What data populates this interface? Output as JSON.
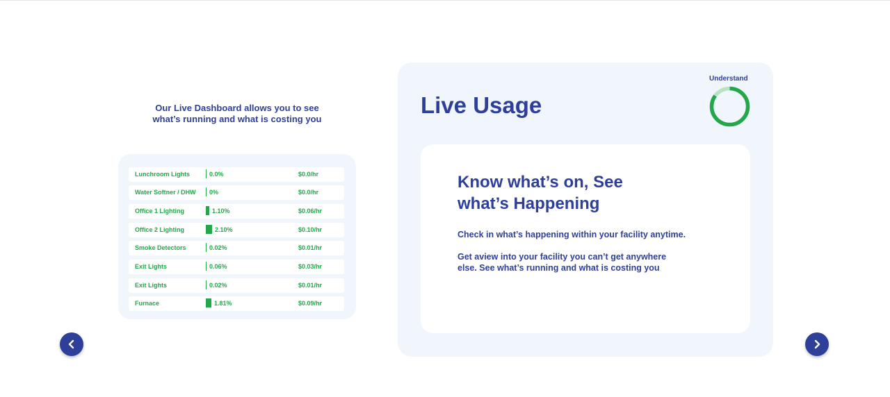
{
  "intro": {
    "line1": "Our Live Dashboard allows you to see",
    "line2": "what’s running and what is costing you"
  },
  "usage": [
    {
      "name": "Lunchroom Lights",
      "percent": "0.0%",
      "percent_value": 0.0,
      "cost": "$0.0/hr"
    },
    {
      "name": "Water Softner / DHW",
      "percent": "0%",
      "percent_value": 0.0,
      "cost": "$0.0/hr"
    },
    {
      "name": "Office 1 Lighting",
      "percent": "1.10%",
      "percent_value": 1.1,
      "cost": "$0.06/hr"
    },
    {
      "name": "Office 2 Lighting",
      "percent": "2.10%",
      "percent_value": 2.1,
      "cost": "$0.10/hr"
    },
    {
      "name": "Smoke Detectors",
      "percent": "0.02%",
      "percent_value": 0.02,
      "cost": "$0.01/hr"
    },
    {
      "name": "Exit Lights",
      "percent": "0.06%",
      "percent_value": 0.06,
      "cost": "$0.03/hr"
    },
    {
      "name": "Exit Lights",
      "percent": "0.02%",
      "percent_value": 0.02,
      "cost": "$0.01/hr"
    },
    {
      "name": "Furnace",
      "percent": "1.81%",
      "percent_value": 1.81,
      "cost": "$0.09/hr"
    }
  ],
  "live": {
    "title": "Live Usage",
    "understand_label": "Understand",
    "ring": {
      "fraction": 0.85,
      "color": "#22a84a",
      "track_color": "#b5e3c3"
    },
    "heading_line1": "Know what’s on, See",
    "heading_line2": "what’s Happening",
    "paragraph1": "Check in what’s happening within your facility anytime.",
    "paragraph2_line1": "Get aview into your facility you can’t get anywhere",
    "paragraph2_line2": "else. See what’s running and what is costing you"
  },
  "nav": {
    "prev_icon": "chevron-left-icon",
    "next_icon": "chevron-right-icon"
  },
  "colors": {
    "brand": "#2e3f9a",
    "green": "#22a84a",
    "card_bg": "#f1f6fd"
  }
}
